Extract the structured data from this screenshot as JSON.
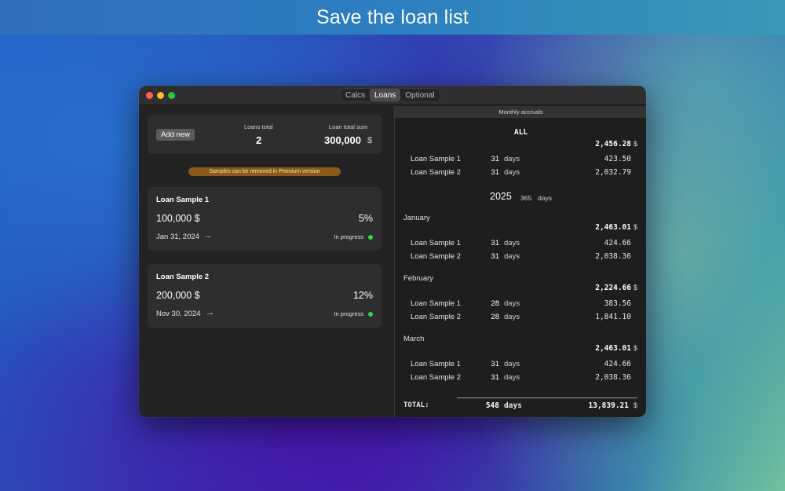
{
  "banner": {
    "title": "Save the loan list"
  },
  "window": {
    "tabs": [
      {
        "label": "Calcs",
        "active": false
      },
      {
        "label": "Loans",
        "active": true
      },
      {
        "label": "Optional",
        "active": false
      }
    ]
  },
  "summary": {
    "add_new_label": "Add new",
    "loans_total_label": "Loans total",
    "loans_total_value": "2",
    "loan_total_sum_label": "Loan total sum",
    "loan_total_sum_value": "300,000",
    "loan_total_sum_unit": "$"
  },
  "premium_notice": "Samples can be removed in Premium version",
  "loans": [
    {
      "name": "Loan Sample 1",
      "amount": "100,000 $",
      "rate": "5%",
      "date": "Jan 31, 2024",
      "arrow": "→",
      "status": "In progress"
    },
    {
      "name": "Loan Sample 2",
      "amount": "200,000 $",
      "rate": "12%",
      "date": "Nov 30, 2024",
      "arrow": "→",
      "status": "In progress"
    }
  ],
  "accruals": {
    "header": "Monthly accruals",
    "all": {
      "label": "ALL",
      "total": "2,456.28",
      "unit": "$",
      "rows": [
        {
          "name": "Loan Sample 1",
          "days": "31",
          "days_word": "days",
          "amount": "423.50"
        },
        {
          "name": "Loan Sample 2",
          "days": "31",
          "days_word": "days",
          "amount": "2,032.79"
        }
      ]
    },
    "year": {
      "label": "2025",
      "days": "365",
      "days_word": "days"
    },
    "months": [
      {
        "name": "January",
        "total": "2,463.01",
        "unit": "$",
        "rows": [
          {
            "name": "Loan Sample 1",
            "days": "31",
            "days_word": "days",
            "amount": "424.66"
          },
          {
            "name": "Loan Sample 2",
            "days": "31",
            "days_word": "days",
            "amount": "2,038.36"
          }
        ]
      },
      {
        "name": "February",
        "total": "2,224.66",
        "unit": "$",
        "rows": [
          {
            "name": "Loan Sample 1",
            "days": "28",
            "days_word": "days",
            "amount": "383.56"
          },
          {
            "name": "Loan Sample 2",
            "days": "28",
            "days_word": "days",
            "amount": "1,841.10"
          }
        ]
      },
      {
        "name": "March",
        "total": "2,463.01",
        "unit": "$",
        "rows": [
          {
            "name": "Loan Sample 1",
            "days": "31",
            "days_word": "days",
            "amount": "424.66"
          },
          {
            "name": "Loan Sample 2",
            "days": "31",
            "days_word": "days",
            "amount": "2,038.36"
          }
        ]
      }
    ],
    "total": {
      "label": "TOTAL:",
      "days": "548",
      "days_word": "days",
      "amount": "13,839.21",
      "unit": "$"
    }
  },
  "colors": {
    "status_in_progress": "#32d74b",
    "premium_pill": "#8a5a18"
  }
}
